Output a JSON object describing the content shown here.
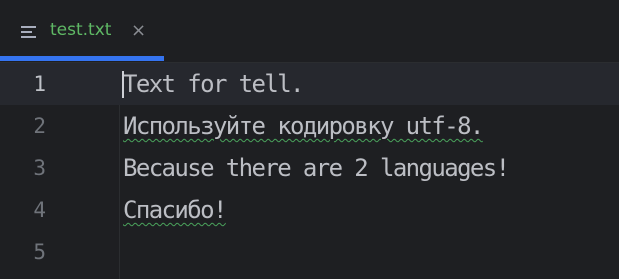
{
  "tab": {
    "file_name": "test.txt",
    "close_glyph": "×",
    "icon": "text-file-icon",
    "active_color": "#3574f0",
    "label_color": "#5fb865"
  },
  "editor": {
    "current_line": 1,
    "lines": [
      {
        "number": "1",
        "text": "Text for tell."
      },
      {
        "number": "2",
        "text": "Используйте кодировку utf-8."
      },
      {
        "number": "3",
        "text": "Because there are 2 languages!"
      },
      {
        "number": "4",
        "text": "Спасибо!"
      },
      {
        "number": "5",
        "text": ""
      }
    ]
  }
}
